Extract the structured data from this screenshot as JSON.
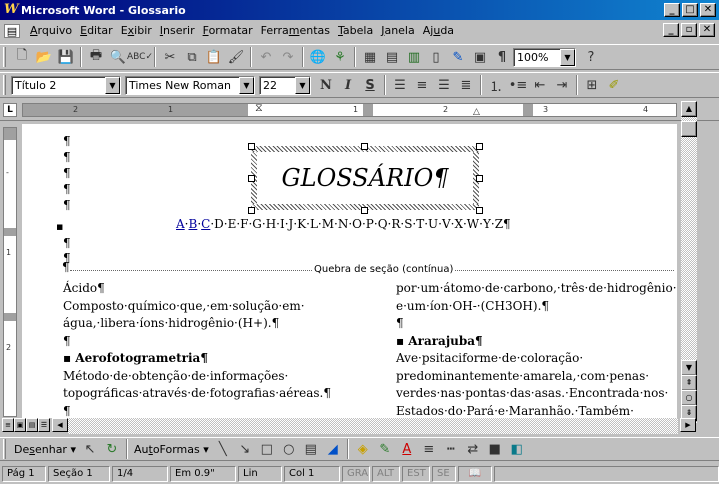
{
  "window": {
    "title": "Microsoft Word - Glossario",
    "app_icon": "W"
  },
  "menu": {
    "items": [
      {
        "label": "Arquivo",
        "key": "A",
        "rest": "rquivo"
      },
      {
        "label": "Editar",
        "key": "E",
        "rest": "ditar"
      },
      {
        "label": "Exibir",
        "key": "x",
        "pre": "E",
        "rest": "ibir"
      },
      {
        "label": "Inserir",
        "key": "I",
        "rest": "nserir"
      },
      {
        "label": "Formatar",
        "key": "F",
        "rest": "ormatar"
      },
      {
        "label": "Ferramentas",
        "key": "m",
        "pre": "Ferra",
        "rest": "entas"
      },
      {
        "label": "Tabela",
        "key": "T",
        "rest": "abela"
      },
      {
        "label": "Janela",
        "key": "J",
        "rest": "anela"
      },
      {
        "label": "Ajuda",
        "key": "u",
        "pre": "Aj",
        "rest": "da"
      }
    ]
  },
  "standard_toolbar": {
    "zoom": "100%"
  },
  "format_toolbar": {
    "style": "Título 2",
    "font": "Times New Roman",
    "size": "22",
    "bold": "N",
    "italic": "I",
    "underline": "S"
  },
  "ruler": {
    "ticks": [
      "2",
      "1",
      "1",
      "2",
      "3",
      "4"
    ]
  },
  "document": {
    "paragraph_mark": "¶",
    "heading": "GLOSSÁRIO¶",
    "alphabet_links": [
      "A",
      "B",
      "C"
    ],
    "alphabet_rest": "·D·E·F·G·H·I·J·K·L·M·N·O·P·Q·R·S·T·U·V·X·W·Y·Z¶",
    "section_break": "Quebra de seção (contínua)",
    "left_column": [
      {
        "text": "Ácido¶",
        "bold": false,
        "bullet": false
      },
      {
        "text": "Composto·químico·que,·em·solução·em·",
        "bold": false,
        "bullet": false
      },
      {
        "text": "água,·libera·íons·hidrogênio·(H+).¶",
        "bold": false,
        "bullet": false
      },
      {
        "text": "¶",
        "bold": false,
        "bullet": false
      },
      {
        "text": "Aerofotogrametria¶",
        "bold": true,
        "bullet": true
      },
      {
        "text": "Método·de·obtenção·de·informações·",
        "bold": false,
        "bullet": false
      },
      {
        "text": "topográficas·através·de·fotografias·aéreas.¶",
        "bold": false,
        "bullet": false
      },
      {
        "text": "¶",
        "bold": false,
        "bullet": false
      }
    ],
    "right_column": [
      {
        "text": "por·um·átomo·de·carbono,·três·de·hidrogênio·",
        "bold": false,
        "bullet": false
      },
      {
        "text": "e·um·íon·OH-·(CH3OH).¶",
        "bold": false,
        "bullet": false
      },
      {
        "text": "¶",
        "bold": false,
        "bullet": false
      },
      {
        "text": "Ararajuba¶",
        "bold": true,
        "bullet": true
      },
      {
        "text": "Ave·psitaciforme·de·coloração·",
        "bold": false,
        "bullet": false
      },
      {
        "text": "predominantemente·amarela,·com·penas·",
        "bold": false,
        "bullet": false
      },
      {
        "text": "verdes·nas·pontas·das·asas.·Encontrada·nos·",
        "bold": false,
        "bullet": false
      },
      {
        "text": "Estados·do·Pará·e·Maranhão.·Também·",
        "bold": false,
        "bullet": false
      }
    ]
  },
  "drawing_toolbar": {
    "draw_label": "Desenhar",
    "draw_key": "s",
    "autoshapes_label": "AutoFormas",
    "autoshapes_key": "t"
  },
  "status_bar": {
    "page": "Pág 1",
    "section": "Seção 1",
    "page_of": "1/4",
    "position": "Em 0.9\"",
    "line": "Lin",
    "column": "Col 1",
    "modes": [
      "GRA",
      "ALT",
      "EST",
      "SE"
    ]
  },
  "colors": {
    "titlebar_start": "#00007b",
    "titlebar_end": "#1084d0",
    "link": "#00009c",
    "chrome": "#c0c0c0"
  }
}
